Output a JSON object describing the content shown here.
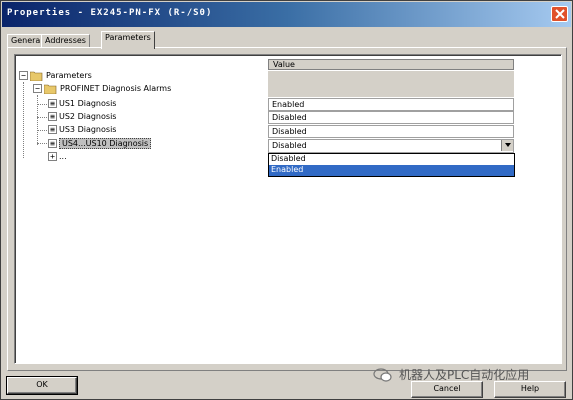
{
  "window": {
    "title": "Properties - EX245-PN-FX (R-/S0)"
  },
  "tabs": [
    {
      "label": "General"
    },
    {
      "label": "Addresses"
    },
    {
      "label": "Parameters"
    }
  ],
  "grid": {
    "value_header": "Value"
  },
  "tree": {
    "root": "Parameters",
    "group": "PROFINET Diagnosis Alarms",
    "items": [
      {
        "label": "US1 Diagnosis",
        "value": "Enabled"
      },
      {
        "label": "US2 Diagnosis",
        "value": "Disabled"
      },
      {
        "label": "US3 Diagnosis",
        "value": "Disabled"
      },
      {
        "label": "US4...US10 Diagnosis",
        "value": "Disabled"
      }
    ],
    "more": "..."
  },
  "dropdown": {
    "options": [
      "Disabled",
      "Enabled"
    ],
    "highlighted": "Enabled"
  },
  "buttons": {
    "ok": "OK",
    "cancel": "Cancel",
    "help": "Help"
  },
  "watermark": {
    "text": "机器人及PLC自动化应用"
  },
  "colors": {
    "selection": "#316ac5",
    "face": "#d4d0c8",
    "close": "#e0512b"
  }
}
